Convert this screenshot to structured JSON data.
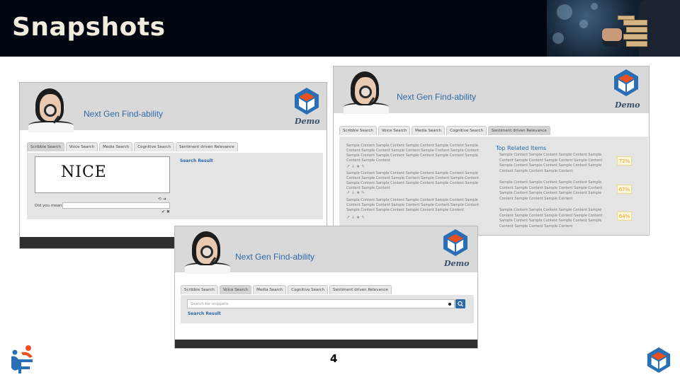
{
  "slide": {
    "title": "Snapshots",
    "page_number": "4"
  },
  "colors": {
    "title_bar": "#00060f",
    "title_text": "#f2ece0",
    "brand_blue": "#2d6aa8",
    "logo_orange": "#e8501e",
    "logo_blue": "#2a6fb5",
    "percent_orange": "#e8a020"
  },
  "icons": {
    "header_photo": "business-hand-jenga-photo",
    "left_corner": "people-network-logo-icon",
    "right_corner": "cube-hexagon-logo-icon",
    "demo_logo": "cube-hexagon-logo-icon"
  },
  "brand_name": "Next Gen Find-ability",
  "demo_label": "Demo",
  "tabs": [
    "Scribble Search",
    "Voice Search",
    "Media Search",
    "Cognitive Search",
    "Sentiment driven Relevance"
  ],
  "scribble_window": {
    "active_tab": "Scribble Search",
    "scribble_text": "NICE",
    "did_you_mean_label": "Did you mean?",
    "search_result_label": "Search Result"
  },
  "sentiment_window": {
    "active_tab": "Sentiment driven Relevance",
    "result_text": "Sample Content Sample Content Sample Content Sample Content Sample Content Sample Content Sample Content Sample Content Sample Content Sample Content Sample Content Sample Content Sample Content Sample Content Sample Content",
    "result_text_short": "Sample Content Sample Content Sample Content Sample Content Sample Content Sample Content Sample Content Sample Content Sample Content Sample Content Sample Content Sample Content Sample Content",
    "result_text_tail": "Sample Content Sample Content Sample Content Sample Content Sample Content Sample Content Sample Content Sample Content Sample Content Sample Content Sample Content Sample Content Sample Content Sample Content",
    "action_icons": "↗ ↓ ★ ✎",
    "top_related_title": "Top Related Items",
    "related_text": "Sample Content Sample Content Sample Content Sample Content Sample Content Sample Content Sample Content Sample Content Sample Content Sample Content Sample Content Sample Content Sample Content",
    "related_percents": [
      "72%",
      "67%",
      "64%"
    ]
  },
  "voice_window": {
    "active_tab": "Voice Search",
    "search_placeholder": "Search for snippets",
    "search_result_label": "Search Result"
  }
}
